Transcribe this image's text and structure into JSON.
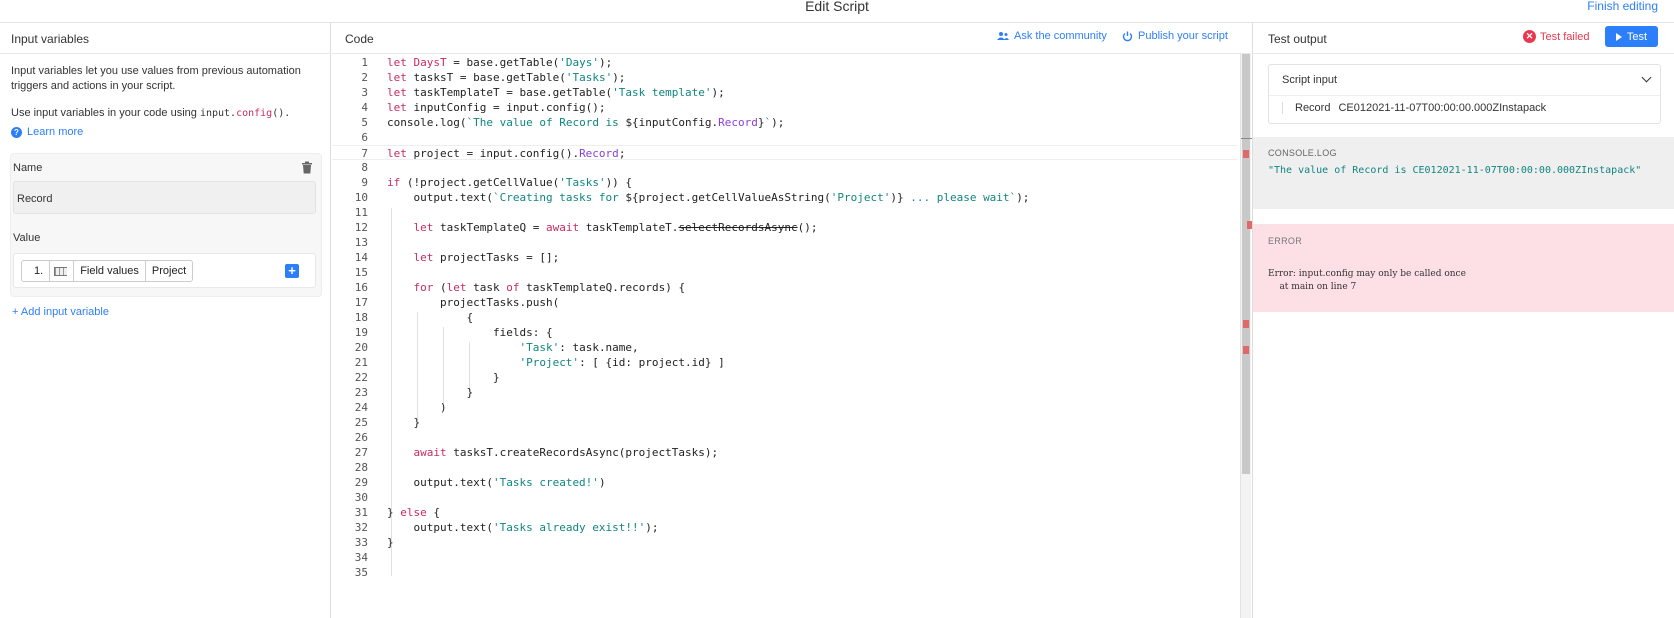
{
  "header": {
    "title": "Edit Script",
    "finish_label": "Finish editing"
  },
  "input_panel": {
    "title": "Input variables",
    "description": "Input variables let you use values from previous automation triggers and actions in your script.",
    "usage_prefix": "Use input variables in your code using ",
    "usage_code_a": "input.",
    "usage_code_b": "config",
    "usage_code_c": "().",
    "learn_more": "Learn more",
    "name_label": "Name",
    "name_value": "Record",
    "value_label": "Value",
    "value_pill": [
      "1.",
      "Field values",
      "Project"
    ],
    "add_variable": "Add input variable"
  },
  "code_panel": {
    "title": "Code",
    "ask_community": "Ask the community",
    "publish": "Publish your script",
    "line_numbers": [
      "1",
      "2",
      "3",
      "4",
      "5",
      "6",
      "7",
      "8",
      "9",
      "10",
      "11",
      "12",
      "13",
      "14",
      "15",
      "16",
      "17",
      "18",
      "19",
      "20",
      "21",
      "22",
      "23",
      "24",
      "25",
      "26",
      "27",
      "28",
      "29",
      "30",
      "31",
      "32",
      "33",
      "34",
      "35"
    ]
  },
  "output_panel": {
    "title": "Test output",
    "status": "Test failed",
    "test_button": "Test",
    "script_input_label": "Script input",
    "record_label": "Record",
    "record_value": "CE012021-11-07T00:00:00.000ZInstapack",
    "console_label": "CONSOLE.LOG",
    "console_message": "\"The value of Record is CE012021-11-07T00:00:00.000ZInstapack\"",
    "error_label": "ERROR",
    "error_message": "Error: input.config may only be called once\n    at main on line 7"
  },
  "colors": {
    "accent": "#2d7ff9",
    "error": "#e8384f",
    "keyword": "#c62c5f",
    "string": "#11857f",
    "property": "#8b3fd9"
  }
}
